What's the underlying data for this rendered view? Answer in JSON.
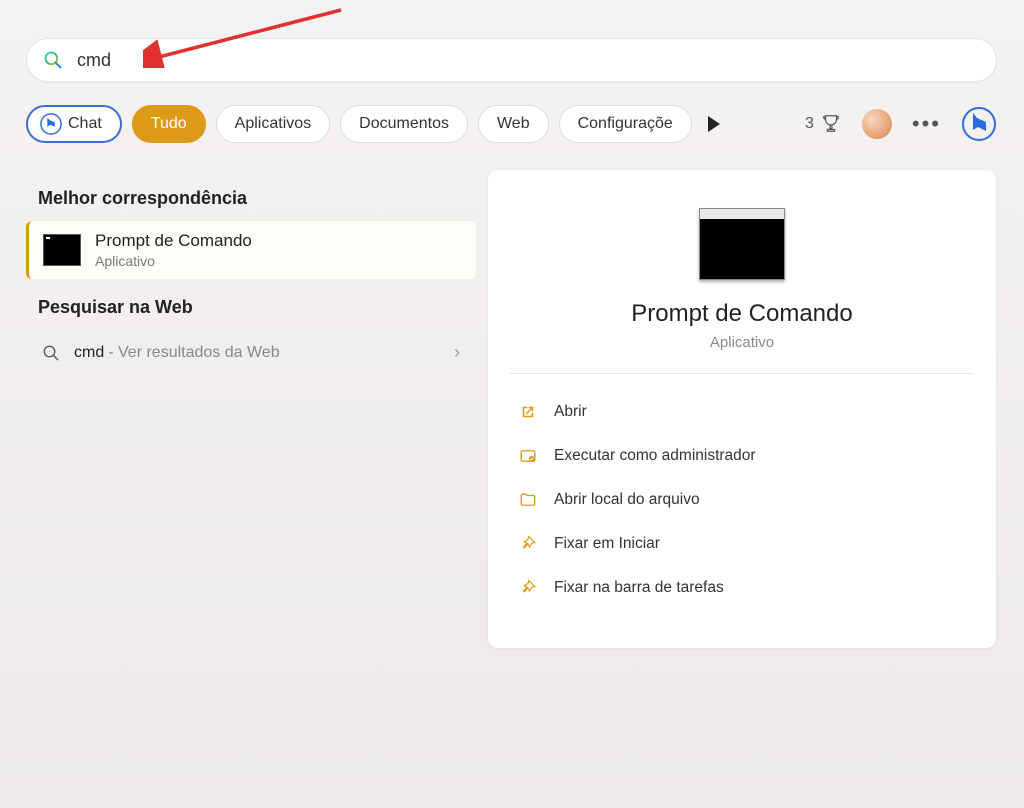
{
  "search": {
    "value": "cmd"
  },
  "tabs": {
    "chat": "Chat",
    "all": "Tudo",
    "apps": "Aplicativos",
    "docs": "Documentos",
    "web": "Web",
    "settings": "Configuraçõe"
  },
  "rewards_count": "3",
  "left": {
    "best_match_header": "Melhor correspondência",
    "best_match": {
      "title": "Prompt de Comando",
      "subtitle": "Aplicativo"
    },
    "web_search_header": "Pesquisar na Web",
    "web_search": {
      "query": "cmd",
      "suffix": "- Ver resultados da Web"
    }
  },
  "right": {
    "title": "Prompt de Comando",
    "subtitle": "Aplicativo",
    "actions": [
      {
        "icon": "open",
        "label": "Abrir"
      },
      {
        "icon": "admin",
        "label": "Executar como administrador"
      },
      {
        "icon": "folder",
        "label": "Abrir local do arquivo"
      },
      {
        "icon": "pin",
        "label": "Fixar em Iniciar"
      },
      {
        "icon": "pin",
        "label": "Fixar na barra de tarefas"
      }
    ]
  },
  "colors": {
    "accent": "#dd9a16",
    "chat_border": "#3b6ed0"
  }
}
